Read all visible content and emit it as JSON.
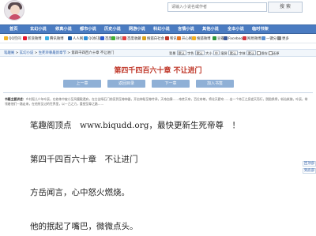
{
  "header": {
    "search_placeholder": "请输入小说名或作者",
    "search_button": "搜 索"
  },
  "nav": [
    "首页",
    "玄幻小说",
    "修真小说",
    "都市小说",
    "历史小说",
    "网游小说",
    "科幻小说",
    "言情小说",
    "其他小说",
    "全本小说",
    "临时书架"
  ],
  "toolbar": [
    "QQ空间",
    "新浪微博",
    "腾讯微博",
    "人人网",
    "QQ好友",
    "百度",
    "微信",
    "百度收藏",
    "搜狐白社会",
    "和讯",
    "开心网",
    "搜狐微博",
    "豆瓣",
    "Facebook",
    "网易微博",
    "一键分享",
    "更多"
  ],
  "breadcrumb": {
    "home": "笔趣阁",
    "sep1": " > ",
    "category": "玄幻小说",
    "sep2": " > ",
    "book": "生死帝尊最新章节",
    "sep3": " > ",
    "chapter": "第四千四百六十章 不让进门"
  },
  "settings": {
    "bg_label": "背景",
    "bg_value": "默认",
    "color_label": "字色",
    "color_value": "默认",
    "size_label": "大小",
    "size_value": "中",
    "speed_label": "滚屏",
    "speed_value": "默认",
    "font_label": "字体",
    "font_value": "默认",
    "save_label": "保存",
    "restore_label": "还原"
  },
  "chapter_title": "第四千四百六十章 不让进门",
  "chapter_nav": {
    "prev": "上一章",
    "index": "返回目录",
    "next": "下一章",
    "bookshelf": "加入书签"
  },
  "intro": {
    "label": "书籍主要讲述：",
    "text": "乡村孤儿少年叶辰，在修炼中被小至风魔殿遗弃，在古战场石门前觅到至尊神器，开启神秘至尊传承，天帝血脉……帝焚天帝，百位帝尊，将化天碧穹……自一个帝王之身逆天而行，脱胎换骨，斩仙弑佛，叶辰，带领着他们一路走来，在他所见过的世界里，以一己之力，重塑至尊之路……"
  },
  "content": [
    "笔趣阁顶点　www.biqudd.org，最快更新生死帝尊　！",
    "第四千四百六十章　不让进门",
    "方岳闻言，心中怒火燃烧。",
    "他的抿起了嘴巴，微微点头。"
  ],
  "side_buttons": {
    "top": "回顶部",
    "bottom": "到底部"
  },
  "colors": {
    "nav_bg": "#4a7bc1",
    "title": "#c0392b",
    "chapter_btn": "#8fb0d6",
    "crumb_bg": "#f1f6fb"
  }
}
